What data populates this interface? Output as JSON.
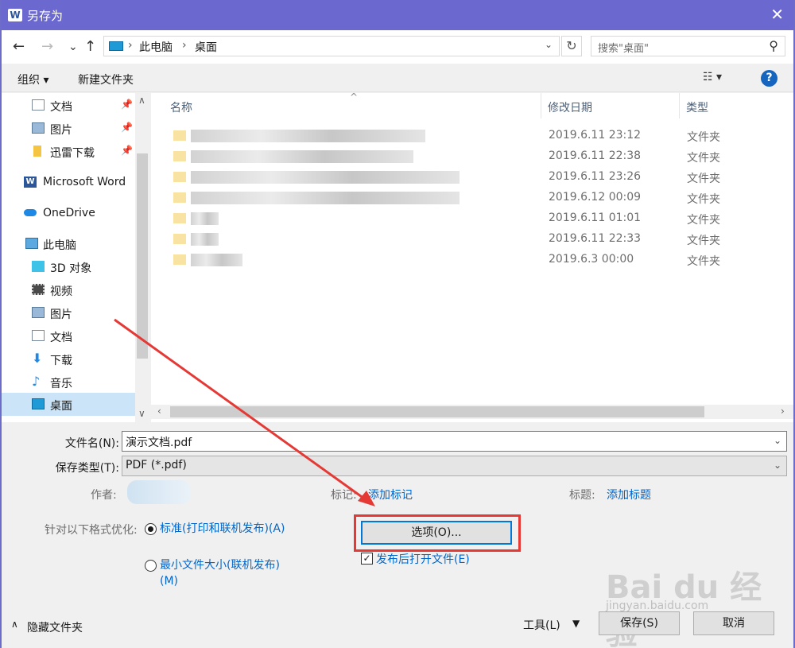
{
  "window": {
    "title": "另存为",
    "app_icon": "word-icon"
  },
  "nav": {
    "back": "←",
    "forward": "→",
    "recent": "⌄",
    "up": "↑"
  },
  "address": {
    "crumbs": [
      "此电脑",
      "桌面"
    ]
  },
  "search": {
    "placeholder": "搜索\"桌面\""
  },
  "toolbar": {
    "organize": "组织 ▾",
    "new_folder": "新建文件夹"
  },
  "sidebar": {
    "items": [
      {
        "label": "文档",
        "pinned": true
      },
      {
        "label": "图片",
        "pinned": true
      },
      {
        "label": "迅雷下载",
        "pinned": true
      },
      {
        "label": "Microsoft Word"
      },
      {
        "label": "OneDrive"
      },
      {
        "label": "此电脑"
      },
      {
        "label": "3D 对象"
      },
      {
        "label": "视频"
      },
      {
        "label": "图片"
      },
      {
        "label": "文档"
      },
      {
        "label": "下载"
      },
      {
        "label": "音乐"
      },
      {
        "label": "桌面",
        "selected": true
      }
    ]
  },
  "files": {
    "columns": {
      "name": "名称",
      "date": "修改日期",
      "type": "类型"
    },
    "rows": [
      {
        "date": "2019.6.11 23:12",
        "type": "文件夹"
      },
      {
        "date": "2019.6.11 22:38",
        "type": "文件夹"
      },
      {
        "date": "2019.6.11 23:26",
        "type": "文件夹"
      },
      {
        "date": "2019.6.12 00:09",
        "type": "文件夹"
      },
      {
        "date": "2019.6.11 01:01",
        "type": "文件夹"
      },
      {
        "date": "2019.6.11 22:33",
        "type": "文件夹"
      },
      {
        "date": "2019.6.3 00:00",
        "type": "文件夹"
      }
    ]
  },
  "form": {
    "filename_label": "文件名(N):",
    "filename_value": "演示文档.pdf",
    "filetype_label": "保存类型(T):",
    "filetype_value": "PDF (*.pdf)",
    "author_label": "作者:",
    "tags_label": "标记:",
    "tags_link": "添加标记",
    "title_label": "标题:",
    "title_link": "添加标题",
    "optimize_label": "针对以下格式优化:",
    "option_standard": "标准(打印和联机发布)(A)",
    "option_min": "最小文件大小(联机发布)(M)",
    "options_button": "选项(O)...",
    "open_after": "发布后打开文件(E)"
  },
  "footer": {
    "hide_folders": "隐藏文件夹",
    "tools": "工具(L)",
    "save": "保存(S)",
    "cancel": "取消"
  },
  "watermark": {
    "brand": "Bai du 经验",
    "url": "jingyan.baidu.com"
  }
}
